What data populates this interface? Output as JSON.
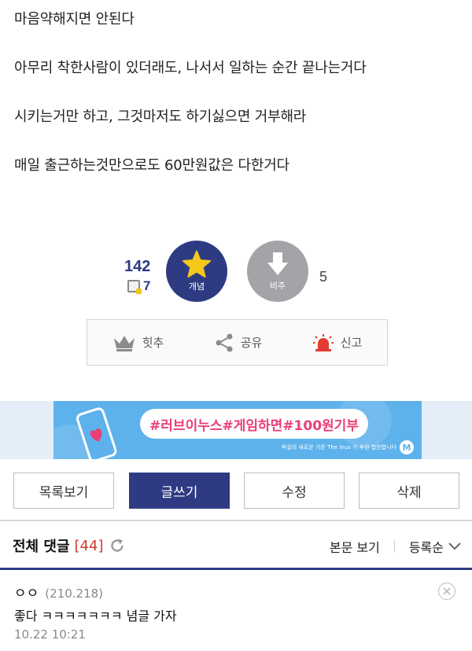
{
  "article": {
    "paragraphs": [
      "마음약해지면 안된다",
      "아무리 착한사람이 있더래도, 나서서 일하는 순간 끝나는거다",
      "시키는거만 하고, 그것마저도 하기싫으면 거부해라",
      "매일 출근하는것만으로도 60만원값은 다한거다"
    ]
  },
  "votes": {
    "up_count": "142",
    "fix_count": "7",
    "up_label": "개념",
    "down_label": "비추",
    "down_count": "5"
  },
  "actions": {
    "hit_label": "힛추",
    "share_label": "공유",
    "report_label": "신고"
  },
  "banner": {
    "text": "#러브이누스#게임하면#100원기부",
    "sub": "욕실의 새로운 기준 The inus 가 후원·협찬합니다"
  },
  "buttons": {
    "list": "목록보기",
    "write": "글쓰기",
    "edit": "수정",
    "delete": "삭제"
  },
  "comments_header": {
    "title": "전체 댓글",
    "count": "[44]",
    "view_body": "본문 보기",
    "sort": "등록순"
  },
  "comments": [
    {
      "author": "ㅇㅇ",
      "ip": "(210.218)",
      "body": "좋다 ㅋㅋㅋㅋㅋㅋㅋ 념글 가자",
      "date": "10.22 10:21"
    }
  ],
  "colors": {
    "navy": "#2e3b83",
    "gray_button": "#a4a4a8",
    "star": "#f5c91c",
    "accent_red": "#d23a2e",
    "banner_blue": "#5eb2ec",
    "banner_pink": "#ea3f74"
  }
}
